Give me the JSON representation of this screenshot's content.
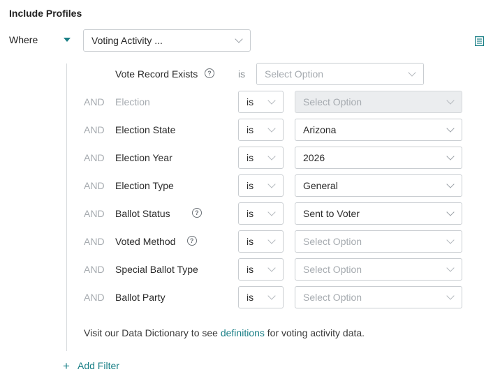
{
  "title": "Include Profiles",
  "where": {
    "label": "Where",
    "selected": "Voting Activity ...",
    "icons": {
      "toggle": "caret-down-icon",
      "list": "list-view-icon"
    }
  },
  "vote_record": {
    "label": "Vote Record Exists",
    "operator": "is",
    "value_placeholder": "Select Option"
  },
  "rows": [
    {
      "conj": "AND",
      "label": "Election",
      "operator": "is",
      "value": "",
      "placeholder": "Select Option",
      "disabled": true,
      "help": false
    },
    {
      "conj": "AND",
      "label": "Election State",
      "operator": "is",
      "value": "Arizona",
      "placeholder": "Select Option",
      "disabled": false,
      "help": false
    },
    {
      "conj": "AND",
      "label": "Election Year",
      "operator": "is",
      "value": "2026",
      "placeholder": "Select Option",
      "disabled": false,
      "help": false
    },
    {
      "conj": "AND",
      "label": "Election Type",
      "operator": "is",
      "value": "General",
      "placeholder": "Select Option",
      "disabled": false,
      "help": false
    },
    {
      "conj": "AND",
      "label": "Ballot Status",
      "operator": "is",
      "value": "Sent to Voter",
      "placeholder": "Select Option",
      "disabled": false,
      "help": true
    },
    {
      "conj": "AND",
      "label": "Voted Method",
      "operator": "is",
      "value": "",
      "placeholder": "Select Option",
      "disabled": false,
      "help": true
    },
    {
      "conj": "AND",
      "label": "Special Ballot Type",
      "operator": "is",
      "value": "",
      "placeholder": "Select Option",
      "disabled": false,
      "help": false
    },
    {
      "conj": "AND",
      "label": "Ballot Party",
      "operator": "is",
      "value": "",
      "placeholder": "Select Option",
      "disabled": false,
      "help": false
    }
  ],
  "help_glyph": "?",
  "footer": {
    "prefix": "Visit our Data Dictionary to see ",
    "link": "definitions",
    "suffix": " for voting activity data."
  },
  "add_filter": {
    "icon": "+",
    "label": "Add Filter"
  },
  "colors": {
    "accent": "#1a7f86",
    "border": "#c9cdd1",
    "muted": "#a6abb0",
    "disabled_bg": "#ebedef"
  }
}
